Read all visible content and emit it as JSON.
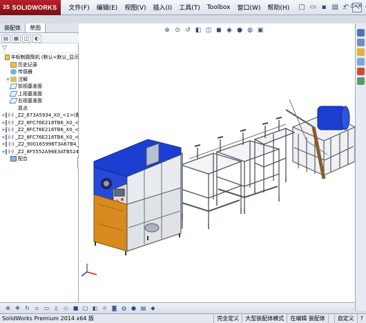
{
  "app": {
    "logo_brand": "SOLIDWORKS",
    "logo_prefix": "3S",
    "menus": [
      "文件(F)",
      "编辑(E)",
      "视图(V)",
      "插入(I)",
      "工具(T)",
      "Toolbox",
      "窗口(W)",
      "帮助(H)"
    ]
  },
  "feature_manager": {
    "tabs": [
      "装配体",
      "草图"
    ],
    "active_tab": 1,
    "filter_icon": "filter-icon",
    "items": [
      {
        "label": "丰标制圆筒机 (默认<默认_显示",
        "icon": "asm",
        "exp": "",
        "indent": 0
      },
      {
        "label": "历史记录",
        "icon": "folder",
        "exp": "",
        "indent": 1
      },
      {
        "label": "传感器",
        "icon": "sensor",
        "exp": "",
        "indent": 1
      },
      {
        "label": "注解",
        "icon": "annot",
        "exp": "+",
        "indent": 1
      },
      {
        "label": "前视基准面",
        "icon": "plane",
        "exp": "",
        "indent": 1
      },
      {
        "label": "上视基准面",
        "icon": "plane",
        "exp": "",
        "indent": 1
      },
      {
        "label": "右视基准面",
        "icon": "plane",
        "exp": "",
        "indent": 1
      },
      {
        "label": "原点",
        "icon": "origin",
        "exp": "",
        "indent": 1
      },
      {
        "label": "(-) _Z2_673A5934_X0_<1>(默",
        "icon": "part",
        "exp": "+",
        "indent": 0
      },
      {
        "label": "(-) _Z2_8FC76E216TB6_X0_<",
        "icon": "part",
        "exp": "+",
        "indent": 0
      },
      {
        "label": "(-) _Z2_8FC76E216TB6_X0_<",
        "icon": "part",
        "exp": "+",
        "indent": 0
      },
      {
        "label": "(-) _Z2_8FC76E216TB6_X0_<",
        "icon": "part",
        "exp": "+",
        "indent": 0
      },
      {
        "label": "(-) _Z2_900165996T3A67B4_",
        "icon": "part",
        "exp": "+",
        "indent": 0
      },
      {
        "label": "(-) _Z2_8F5552A96E3ATB524",
        "icon": "part",
        "exp": "+",
        "indent": 0
      },
      {
        "label": "配合",
        "icon": "mate",
        "exp": "",
        "indent": 1
      }
    ]
  },
  "status": {
    "version": "SolidWorks Premium 2014 x64 版",
    "cells": [
      "完全定义",
      "大型装配体模式",
      "在编辑 装配体",
      "",
      "自定义",
      "?"
    ]
  },
  "colors": {
    "machine_blue": "#1a3fd1",
    "frame_gray": "#6b6f78",
    "panel_orange": "#d88a1e"
  }
}
